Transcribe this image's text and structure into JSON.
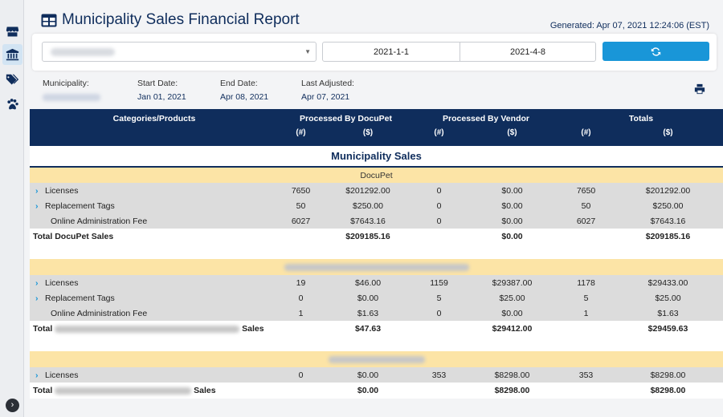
{
  "header": {
    "title": "Municipality Sales Financial Report",
    "generated": "Generated: Apr 07, 2021 12:24:06 (EST)"
  },
  "filters": {
    "municipality_placeholder": "",
    "start_date": "2021-1-1",
    "end_date": "2021-4-8"
  },
  "info": {
    "municipality_label": "Municipality:",
    "start_label": "Start Date:",
    "start_value": "Jan 01, 2021",
    "end_label": "End Date:",
    "end_value": "Apr 08, 2021",
    "adjusted_label": "Last Adjusted:",
    "adjusted_value": "Apr 07, 2021"
  },
  "table": {
    "headers": {
      "categories": "Categories/Products",
      "docupet": "Processed By DocuPet",
      "vendor": "Processed By Vendor",
      "totals": "Totals",
      "count": "(#)",
      "amount": "($)"
    },
    "section_title": "Municipality Sales",
    "group1": {
      "name": "DocuPet",
      "rows": [
        {
          "name": "Licenses",
          "d_n": "7650",
          "d_amt": "$201292.00",
          "v_n": "0",
          "v_amt": "$0.00",
          "t_n": "7650",
          "t_amt": "$201292.00"
        },
        {
          "name": "Replacement Tags",
          "d_n": "50",
          "d_amt": "$250.00",
          "v_n": "0",
          "v_amt": "$0.00",
          "t_n": "50",
          "t_amt": "$250.00"
        },
        {
          "name": "Online Administration Fee",
          "d_n": "6027",
          "d_amt": "$7643.16",
          "v_n": "0",
          "v_amt": "$0.00",
          "t_n": "6027",
          "t_amt": "$7643.16"
        }
      ],
      "total_label": "Total DocuPet Sales",
      "total_d": "$209185.16",
      "total_v": "$0.00",
      "total_t": "$209185.16"
    },
    "group2": {
      "rows": [
        {
          "name": "Licenses",
          "d_n": "19",
          "d_amt": "$46.00",
          "v_n": "1159",
          "v_amt": "$29387.00",
          "t_n": "1178",
          "t_amt": "$29433.00"
        },
        {
          "name": "Replacement Tags",
          "d_n": "0",
          "d_amt": "$0.00",
          "v_n": "5",
          "v_amt": "$25.00",
          "t_n": "5",
          "t_amt": "$25.00"
        },
        {
          "name": "Online Administration Fee",
          "d_n": "1",
          "d_amt": "$1.63",
          "v_n": "0",
          "v_amt": "$0.00",
          "t_n": "1",
          "t_amt": "$1.63"
        }
      ],
      "total_prefix": "Total",
      "total_suffix": "Sales",
      "total_d": "$47.63",
      "total_v": "$29412.00",
      "total_t": "$29459.63"
    },
    "group3": {
      "rows": [
        {
          "name": "Licenses",
          "d_n": "0",
          "d_amt": "$0.00",
          "v_n": "353",
          "v_amt": "$8298.00",
          "t_n": "353",
          "t_amt": "$8298.00"
        }
      ],
      "total_prefix": "Total",
      "total_suffix": "Sales",
      "total_d": "$0.00",
      "total_v": "$8298.00",
      "total_t": "$8298.00"
    }
  },
  "colors": {
    "navy": "#0f2d5c",
    "accent": "#1996d8",
    "group_bg": "#fce4a6",
    "row_bg": "#dcdcdc"
  },
  "icons": {
    "sidebar": [
      "store-icon",
      "bank-icon",
      "tags-icon",
      "paw-icon"
    ],
    "title": "table-icon",
    "refresh": "refresh-icon",
    "print": "print-icon",
    "expand": "chevron-right-icon"
  }
}
